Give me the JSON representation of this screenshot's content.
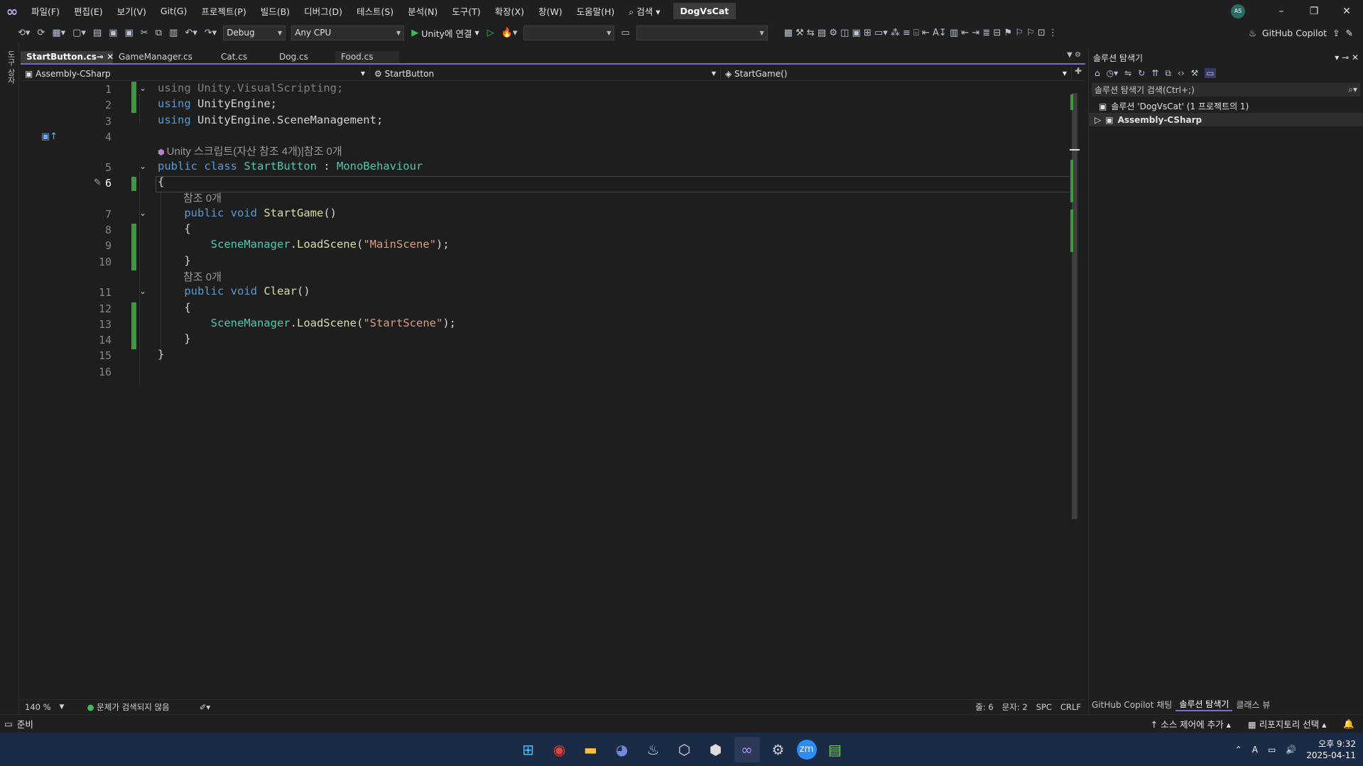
{
  "menu": {
    "items": [
      "파일(F)",
      "편집(E)",
      "보기(V)",
      "Git(G)",
      "프로젝트(P)",
      "빌드(B)",
      "디버그(D)",
      "테스트(S)",
      "분석(N)",
      "도구(T)",
      "확장(X)",
      "창(W)",
      "도움말(H)"
    ],
    "search_label": "검색",
    "solution_name": "DogVsCat",
    "avatar": "AS"
  },
  "toolbar": {
    "config": "Debug",
    "platform": "Any CPU",
    "run_label": "Unity에 연결",
    "copilot": "GitHub Copilot"
  },
  "leftstrip": {
    "label": "도구 상자"
  },
  "tabs": [
    {
      "label": "StartButton.cs",
      "active": true
    },
    {
      "label": "GameManager.cs"
    },
    {
      "label": "Cat.cs"
    },
    {
      "label": "Dog.cs"
    },
    {
      "label": "Food.cs"
    }
  ],
  "navbar": {
    "project": "Assembly-CSharp",
    "type": "StartButton",
    "member": "StartGame()"
  },
  "code": {
    "lens_class": "Unity 스크립트(자산 참조 4개)|참조 0개",
    "lens_method1": "참조 0개",
    "lens_method2": "참조 0개",
    "line_numbers": [
      "1",
      "2",
      "3",
      "4",
      "5",
      "6",
      "7",
      "8",
      "9",
      "10",
      "11",
      "12",
      "13",
      "14",
      "15",
      "16"
    ]
  },
  "editor_status": {
    "zoom": "140 %",
    "issues": "문제가 검색되지 않음",
    "line": "줄: 6",
    "col": "문자: 2",
    "spc": "SPC",
    "eol": "CRLF"
  },
  "solution_explorer": {
    "title": "솔루션 탐색기",
    "search_placeholder": "솔루션 탐색기 검색(Ctrl+;)",
    "solution_node": "솔루션 'DogVsCat' (1 프로젝트의 1)",
    "project_node": "Assembly-CSharp",
    "bottom_tabs": [
      "GitHub Copilot 채팅",
      "솔루션 탐색기",
      "클래스 뷰"
    ]
  },
  "statusbar": {
    "ready": "준비",
    "source_control": "소스 제어에 추가",
    "repo": "리포지토리 선택"
  },
  "tray": {
    "time": "오후 9:32",
    "date": "2025-04-11",
    "ime": "A"
  }
}
